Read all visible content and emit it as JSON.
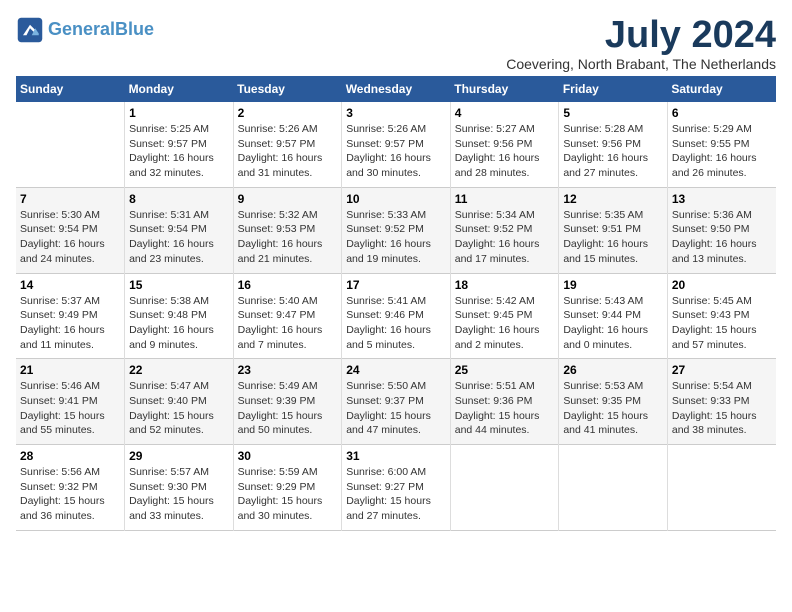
{
  "logo": {
    "line1": "General",
    "line2": "Blue"
  },
  "title": "July 2024",
  "location": "Coevering, North Brabant, The Netherlands",
  "weekdays": [
    "Sunday",
    "Monday",
    "Tuesday",
    "Wednesday",
    "Thursday",
    "Friday",
    "Saturday"
  ],
  "weeks": [
    [
      {
        "day": "",
        "sunrise": "",
        "sunset": "",
        "daylight": ""
      },
      {
        "day": "1",
        "sunrise": "Sunrise: 5:25 AM",
        "sunset": "Sunset: 9:57 PM",
        "daylight": "Daylight: 16 hours and 32 minutes."
      },
      {
        "day": "2",
        "sunrise": "Sunrise: 5:26 AM",
        "sunset": "Sunset: 9:57 PM",
        "daylight": "Daylight: 16 hours and 31 minutes."
      },
      {
        "day": "3",
        "sunrise": "Sunrise: 5:26 AM",
        "sunset": "Sunset: 9:57 PM",
        "daylight": "Daylight: 16 hours and 30 minutes."
      },
      {
        "day": "4",
        "sunrise": "Sunrise: 5:27 AM",
        "sunset": "Sunset: 9:56 PM",
        "daylight": "Daylight: 16 hours and 28 minutes."
      },
      {
        "day": "5",
        "sunrise": "Sunrise: 5:28 AM",
        "sunset": "Sunset: 9:56 PM",
        "daylight": "Daylight: 16 hours and 27 minutes."
      },
      {
        "day": "6",
        "sunrise": "Sunrise: 5:29 AM",
        "sunset": "Sunset: 9:55 PM",
        "daylight": "Daylight: 16 hours and 26 minutes."
      }
    ],
    [
      {
        "day": "7",
        "sunrise": "Sunrise: 5:30 AM",
        "sunset": "Sunset: 9:54 PM",
        "daylight": "Daylight: 16 hours and 24 minutes."
      },
      {
        "day": "8",
        "sunrise": "Sunrise: 5:31 AM",
        "sunset": "Sunset: 9:54 PM",
        "daylight": "Daylight: 16 hours and 23 minutes."
      },
      {
        "day": "9",
        "sunrise": "Sunrise: 5:32 AM",
        "sunset": "Sunset: 9:53 PM",
        "daylight": "Daylight: 16 hours and 21 minutes."
      },
      {
        "day": "10",
        "sunrise": "Sunrise: 5:33 AM",
        "sunset": "Sunset: 9:52 PM",
        "daylight": "Daylight: 16 hours and 19 minutes."
      },
      {
        "day": "11",
        "sunrise": "Sunrise: 5:34 AM",
        "sunset": "Sunset: 9:52 PM",
        "daylight": "Daylight: 16 hours and 17 minutes."
      },
      {
        "day": "12",
        "sunrise": "Sunrise: 5:35 AM",
        "sunset": "Sunset: 9:51 PM",
        "daylight": "Daylight: 16 hours and 15 minutes."
      },
      {
        "day": "13",
        "sunrise": "Sunrise: 5:36 AM",
        "sunset": "Sunset: 9:50 PM",
        "daylight": "Daylight: 16 hours and 13 minutes."
      }
    ],
    [
      {
        "day": "14",
        "sunrise": "Sunrise: 5:37 AM",
        "sunset": "Sunset: 9:49 PM",
        "daylight": "Daylight: 16 hours and 11 minutes."
      },
      {
        "day": "15",
        "sunrise": "Sunrise: 5:38 AM",
        "sunset": "Sunset: 9:48 PM",
        "daylight": "Daylight: 16 hours and 9 minutes."
      },
      {
        "day": "16",
        "sunrise": "Sunrise: 5:40 AM",
        "sunset": "Sunset: 9:47 PM",
        "daylight": "Daylight: 16 hours and 7 minutes."
      },
      {
        "day": "17",
        "sunrise": "Sunrise: 5:41 AM",
        "sunset": "Sunset: 9:46 PM",
        "daylight": "Daylight: 16 hours and 5 minutes."
      },
      {
        "day": "18",
        "sunrise": "Sunrise: 5:42 AM",
        "sunset": "Sunset: 9:45 PM",
        "daylight": "Daylight: 16 hours and 2 minutes."
      },
      {
        "day": "19",
        "sunrise": "Sunrise: 5:43 AM",
        "sunset": "Sunset: 9:44 PM",
        "daylight": "Daylight: 16 hours and 0 minutes."
      },
      {
        "day": "20",
        "sunrise": "Sunrise: 5:45 AM",
        "sunset": "Sunset: 9:43 PM",
        "daylight": "Daylight: 15 hours and 57 minutes."
      }
    ],
    [
      {
        "day": "21",
        "sunrise": "Sunrise: 5:46 AM",
        "sunset": "Sunset: 9:41 PM",
        "daylight": "Daylight: 15 hours and 55 minutes."
      },
      {
        "day": "22",
        "sunrise": "Sunrise: 5:47 AM",
        "sunset": "Sunset: 9:40 PM",
        "daylight": "Daylight: 15 hours and 52 minutes."
      },
      {
        "day": "23",
        "sunrise": "Sunrise: 5:49 AM",
        "sunset": "Sunset: 9:39 PM",
        "daylight": "Daylight: 15 hours and 50 minutes."
      },
      {
        "day": "24",
        "sunrise": "Sunrise: 5:50 AM",
        "sunset": "Sunset: 9:37 PM",
        "daylight": "Daylight: 15 hours and 47 minutes."
      },
      {
        "day": "25",
        "sunrise": "Sunrise: 5:51 AM",
        "sunset": "Sunset: 9:36 PM",
        "daylight": "Daylight: 15 hours and 44 minutes."
      },
      {
        "day": "26",
        "sunrise": "Sunrise: 5:53 AM",
        "sunset": "Sunset: 9:35 PM",
        "daylight": "Daylight: 15 hours and 41 minutes."
      },
      {
        "day": "27",
        "sunrise": "Sunrise: 5:54 AM",
        "sunset": "Sunset: 9:33 PM",
        "daylight": "Daylight: 15 hours and 38 minutes."
      }
    ],
    [
      {
        "day": "28",
        "sunrise": "Sunrise: 5:56 AM",
        "sunset": "Sunset: 9:32 PM",
        "daylight": "Daylight: 15 hours and 36 minutes."
      },
      {
        "day": "29",
        "sunrise": "Sunrise: 5:57 AM",
        "sunset": "Sunset: 9:30 PM",
        "daylight": "Daylight: 15 hours and 33 minutes."
      },
      {
        "day": "30",
        "sunrise": "Sunrise: 5:59 AM",
        "sunset": "Sunset: 9:29 PM",
        "daylight": "Daylight: 15 hours and 30 minutes."
      },
      {
        "day": "31",
        "sunrise": "Sunrise: 6:00 AM",
        "sunset": "Sunset: 9:27 PM",
        "daylight": "Daylight: 15 hours and 27 minutes."
      },
      {
        "day": "",
        "sunrise": "",
        "sunset": "",
        "daylight": ""
      },
      {
        "day": "",
        "sunrise": "",
        "sunset": "",
        "daylight": ""
      },
      {
        "day": "",
        "sunrise": "",
        "sunset": "",
        "daylight": ""
      }
    ]
  ]
}
